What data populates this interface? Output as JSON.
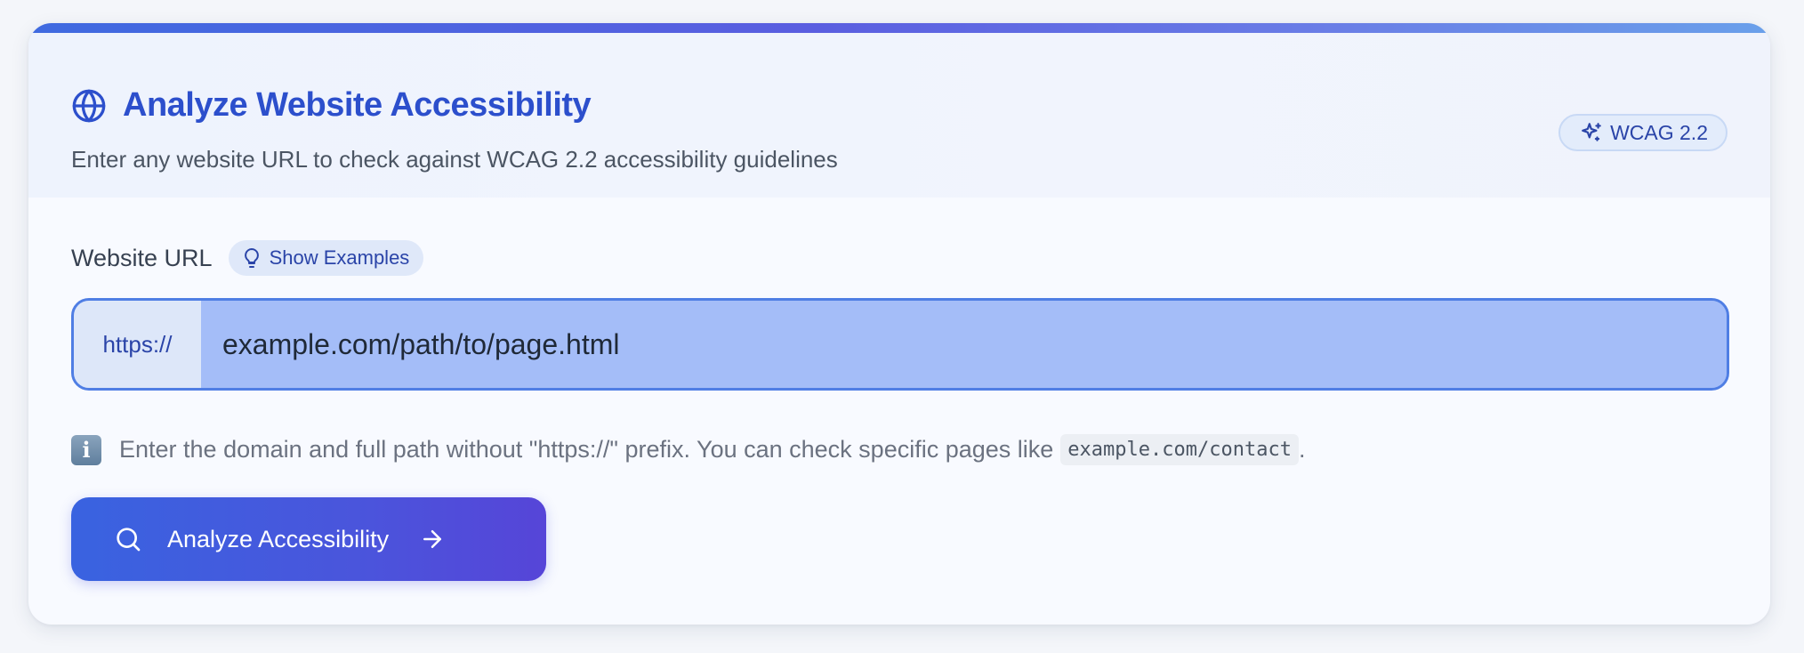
{
  "header": {
    "title": "Analyze Website Accessibility",
    "subtitle": "Enter any website URL to check against WCAG 2.2 accessibility guidelines",
    "badge": "WCAG 2.2",
    "icons": {
      "title": "globe-icon",
      "badge": "sparkles-icon"
    }
  },
  "form": {
    "url_label": "Website URL",
    "examples_button": "Show Examples",
    "examples_icon": "lightbulb-icon",
    "url_prefix": "https://",
    "url_value": "example.com/path/to/page.html",
    "help_icon": "info-icon",
    "help_glyph": "i",
    "help_text": "Enter the domain and full path without \"https://\" prefix. You can check specific pages like",
    "help_code": "example.com/contact",
    "help_suffix": ".",
    "submit_label": "Analyze Accessibility",
    "submit_icons": {
      "leading": "search-icon",
      "trailing": "arrow-right-icon"
    }
  },
  "colors": {
    "accent": "#2c4fcc",
    "button_gradient_start": "#3963e0",
    "button_gradient_end": "#5645d8",
    "input_selection": "#a4bdf8"
  }
}
